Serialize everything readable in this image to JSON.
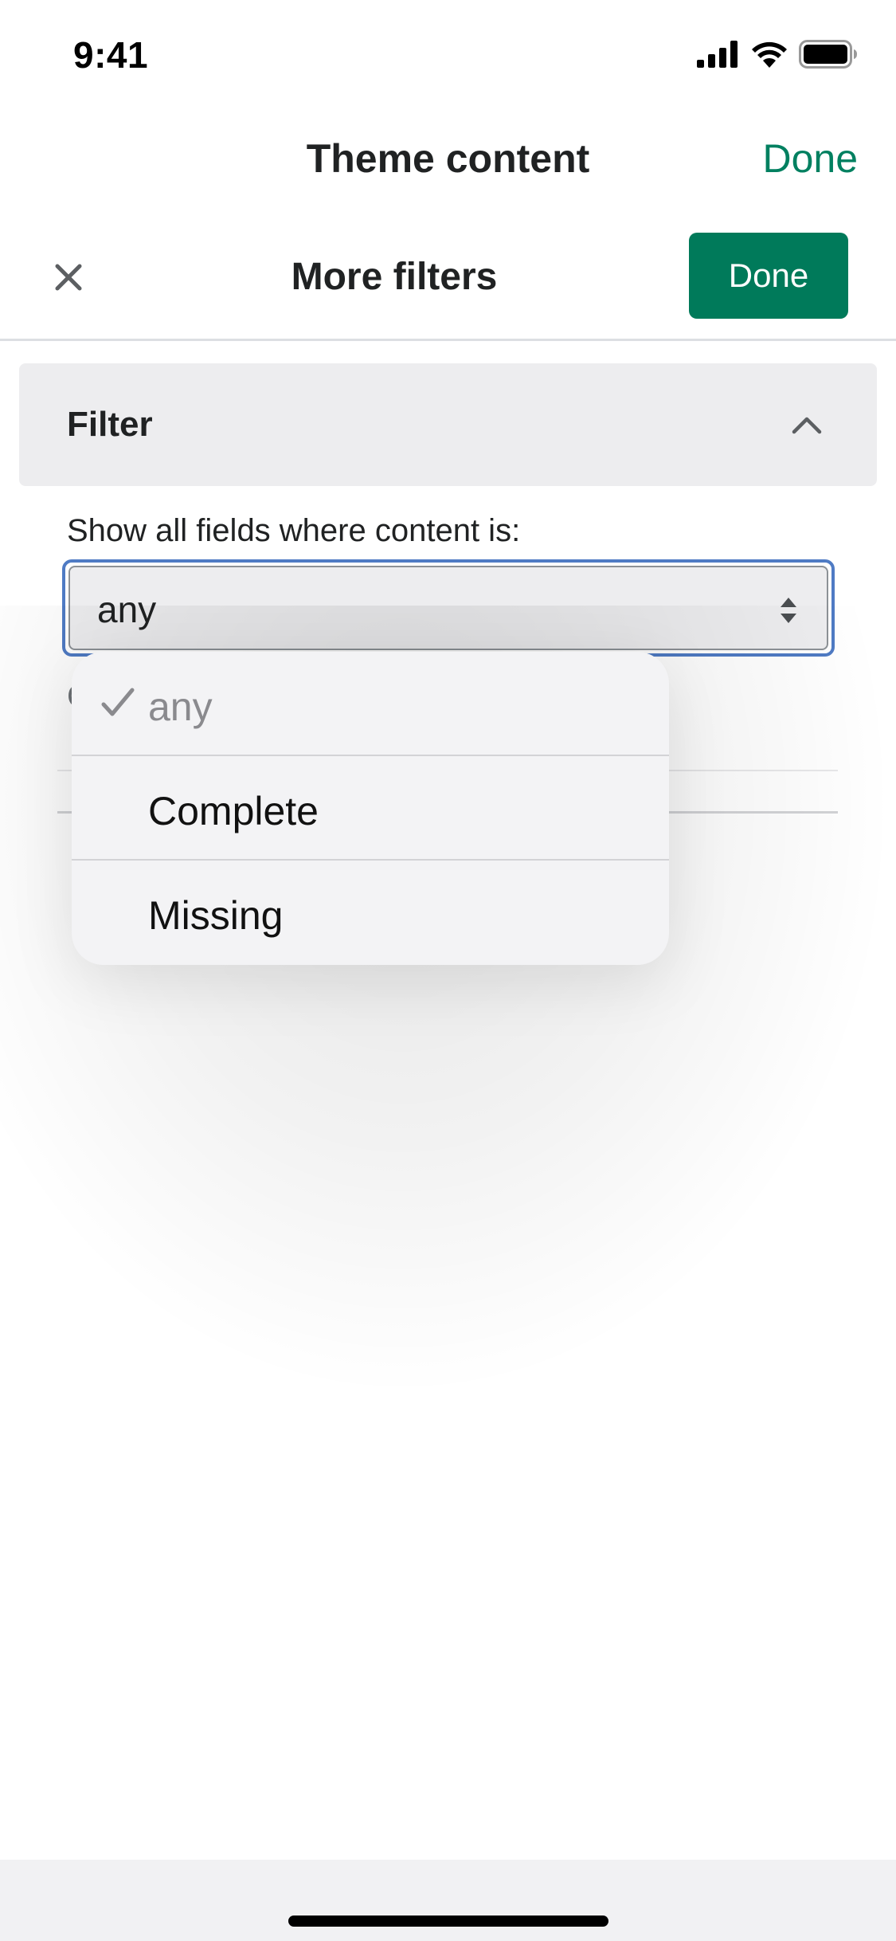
{
  "status_bar": {
    "time": "9:41",
    "icons": [
      "cellular-signal-icon",
      "wifi-icon",
      "battery-icon"
    ]
  },
  "top_nav": {
    "title": "Theme content",
    "done_label": "Done"
  },
  "modal": {
    "title": "More filters",
    "done_label": "Done",
    "close_icon": "close-icon"
  },
  "filter": {
    "section_title": "Filter",
    "label": "Show all fields where content is:",
    "selected_value": "any",
    "options": [
      {
        "label": "any",
        "selected": true
      },
      {
        "label": "Complete",
        "selected": false
      },
      {
        "label": "Missing",
        "selected": false
      }
    ]
  },
  "colors": {
    "accent_green": "#008060",
    "button_green": "#007a5a",
    "focus_blue": "#4f7bc4",
    "section_bg": "#ededef"
  }
}
